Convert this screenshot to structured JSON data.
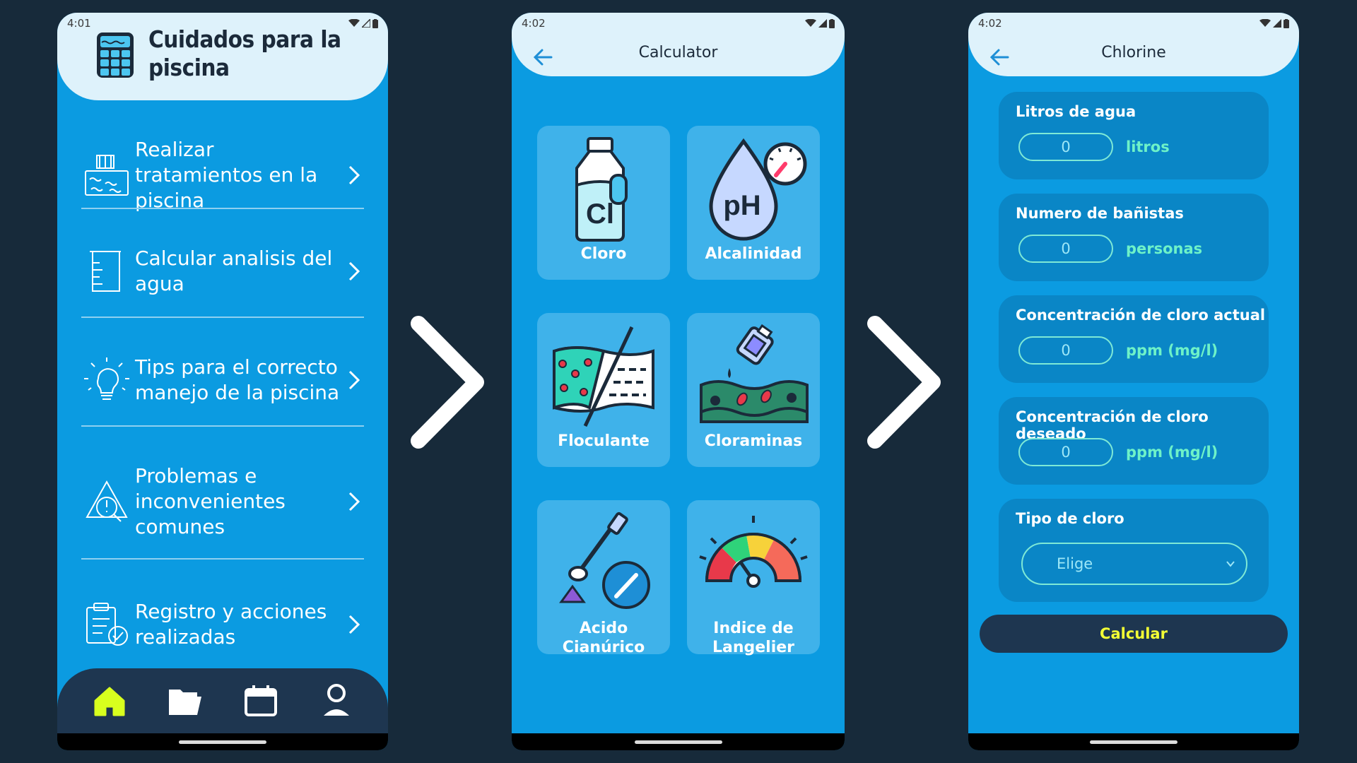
{
  "screen1": {
    "status_time": "4:01",
    "title": "Cuidados para la piscina",
    "menu": [
      {
        "label": "Realizar tratamientos en la piscina",
        "icon": "pool-icon"
      },
      {
        "label": "Calcular analisis del agua",
        "icon": "beaker-icon"
      },
      {
        "label": "Tips para el correcto manejo de la piscina",
        "icon": "lightbulb-icon"
      },
      {
        "label": "Problemas e inconvenientes comunes",
        "icon": "warning-icon"
      },
      {
        "label": "Registro y acciones realizadas",
        "icon": "clipboard-check-icon"
      }
    ],
    "nav": [
      "home-icon",
      "folder-icon",
      "calendar-icon",
      "profile-icon"
    ],
    "nav_active_color": "#d8ff1e"
  },
  "screen2": {
    "status_time": "4:02",
    "title": "Calculator",
    "cards": [
      {
        "label": "Cloro",
        "icon": "chlorine-bottle-icon",
        "icon_text": "Cl"
      },
      {
        "label": "Alcalinidad",
        "icon": "ph-drop-icon",
        "icon_text": "pH"
      },
      {
        "label": "Floculante",
        "icon": "flocculant-icon"
      },
      {
        "label": "Cloraminas",
        "icon": "chloramines-icon"
      },
      {
        "label": "Acido Cianúrico",
        "icon": "cyanuric-acid-icon"
      },
      {
        "label": "Indice de Langelier",
        "icon": "gauge-icon"
      }
    ]
  },
  "screen3": {
    "status_time": "4:02",
    "title": "Chlorine",
    "fields": [
      {
        "label": "Litros de agua",
        "value": "0",
        "unit": "litros"
      },
      {
        "label": "Numero de bañistas",
        "value": "0",
        "unit": "personas"
      },
      {
        "label": "Concentración de cloro actual",
        "value": "0",
        "unit": "ppm (mg/l)"
      },
      {
        "label": "Concentración de cloro deseado",
        "value": "0",
        "unit": "ppm (mg/l)"
      }
    ],
    "select": {
      "label": "Tipo de cloro",
      "value": "Elige"
    },
    "button": "Calcular"
  },
  "colors": {
    "background": "#172a3a",
    "screen": "#0b9be1",
    "header": "#def2fb",
    "nav": "#1e3650",
    "accent_unit": "#6ef2c8",
    "button_text": "#f2ff35"
  }
}
